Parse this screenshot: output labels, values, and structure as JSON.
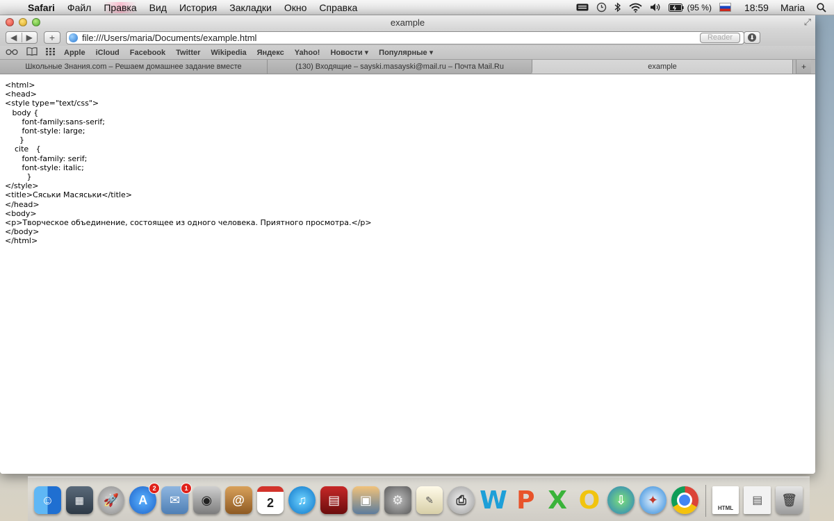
{
  "menubar": {
    "app_name": "Safari",
    "menus": [
      "Файл",
      "Правка",
      "Вид",
      "История",
      "Закладки",
      "Окно",
      "Справка"
    ],
    "battery_percent": "(95 %)",
    "time": "18:59",
    "user": "Maria"
  },
  "window": {
    "title": "example"
  },
  "toolbar": {
    "back": "◀",
    "forward": "▶",
    "new_tab": "+",
    "url": "file:///Users/maria/Documents/example.html",
    "reader_label": "Reader"
  },
  "bookmarks": [
    "Apple",
    "iCloud",
    "Facebook",
    "Twitter",
    "Wikipedia",
    "Яндекс",
    "Yahoo!",
    "Новости ▾",
    "Популярные ▾"
  ],
  "tabs": [
    {
      "label": "Школьные Знания.com – Решаем домашнее задание вместе",
      "active": false
    },
    {
      "label": "(130) Входящие – sayski.masayski@mail.ru – Почта Mail.Ru",
      "active": false
    },
    {
      "label": "example",
      "active": true
    }
  ],
  "content": {
    "lines": [
      "<html>",
      "<head>",
      "<style type=\"text/css\">",
      "   body {",
      "       font-family:sans-serif;",
      "       font-style: large;",
      "      }",
      "    cite   {",
      "       font-family: serif;",
      "       font-style: italic;",
      "         }",
      "</style>",
      "<title>Сяськи Масяськи</title>",
      "</head>",
      "<body>",
      "<p>Творческое объединение, состоящее из одного человека. Приятного просмотра.</p>",
      "</body>",
      "</html>"
    ]
  },
  "dock": {
    "appstore_badge": "2",
    "mail_badge": "1",
    "calendar_day": "2",
    "html_label": "HTML"
  }
}
